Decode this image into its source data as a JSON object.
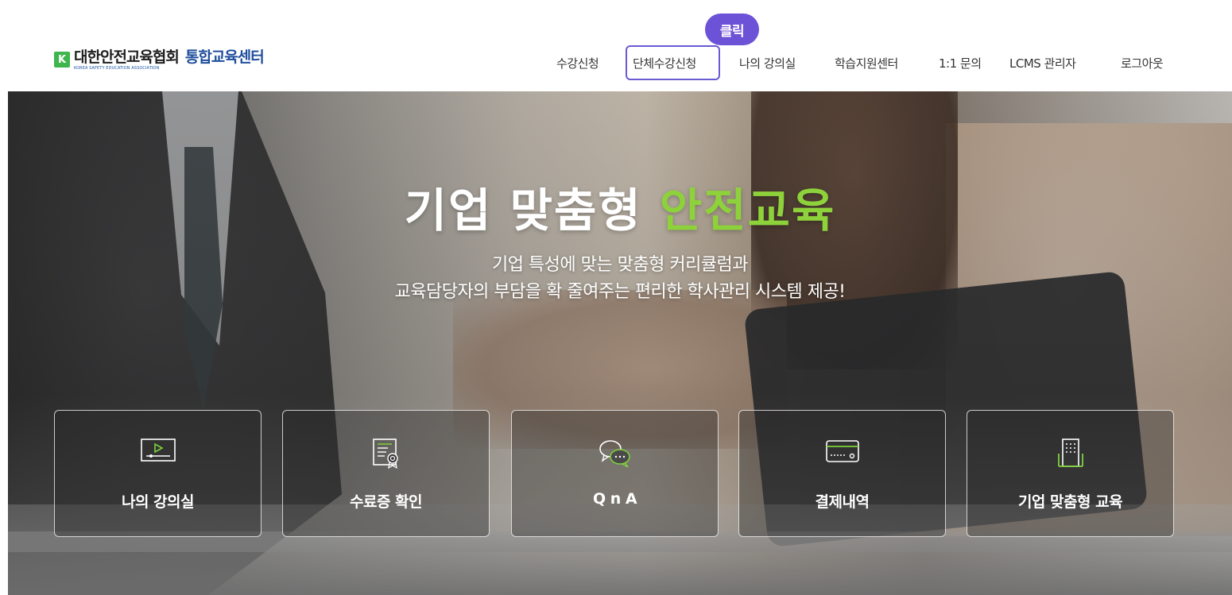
{
  "header": {
    "logo": {
      "mark": "K",
      "org_name": "대한안전교육협회",
      "org_name_en": "KOREA SAFETY EDUCATION ASSOCIATION",
      "center_name": "통합교육센터"
    },
    "nav": [
      {
        "label": "수강신청"
      },
      {
        "label": "단체수강신청"
      },
      {
        "label": "나의 강의실"
      },
      {
        "label": "학습지원센터"
      },
      {
        "label": "1:1 문의"
      },
      {
        "label": "LCMS 관리자"
      },
      {
        "label": "로그아웃"
      }
    ],
    "click_badge": "클릭"
  },
  "hero": {
    "title_main": "기업 맞춤형 ",
    "title_accent": "안전교육",
    "subtitle_line1": "기업 특성에 맞는 맞춤형 커리큘럼과",
    "subtitle_line2": "교육담당자의 부담을 확 줄여주는 편리한 학사관리 시스템 제공!",
    "cards": [
      {
        "label": "나의 강의실",
        "icon": "video-player-icon"
      },
      {
        "label": "수료증 확인",
        "icon": "certificate-icon"
      },
      {
        "label": "Q n A",
        "icon": "chat-bubbles-icon"
      },
      {
        "label": "결제내역",
        "icon": "credit-card-icon"
      },
      {
        "label": "기업 맞춤형 교육",
        "icon": "building-icon"
      }
    ]
  },
  "colors": {
    "accent_green": "#8ed23b",
    "logo_green": "#3fb54d",
    "logo_blue": "#1f4e9c",
    "highlight_purple": "#6a5ad2"
  }
}
